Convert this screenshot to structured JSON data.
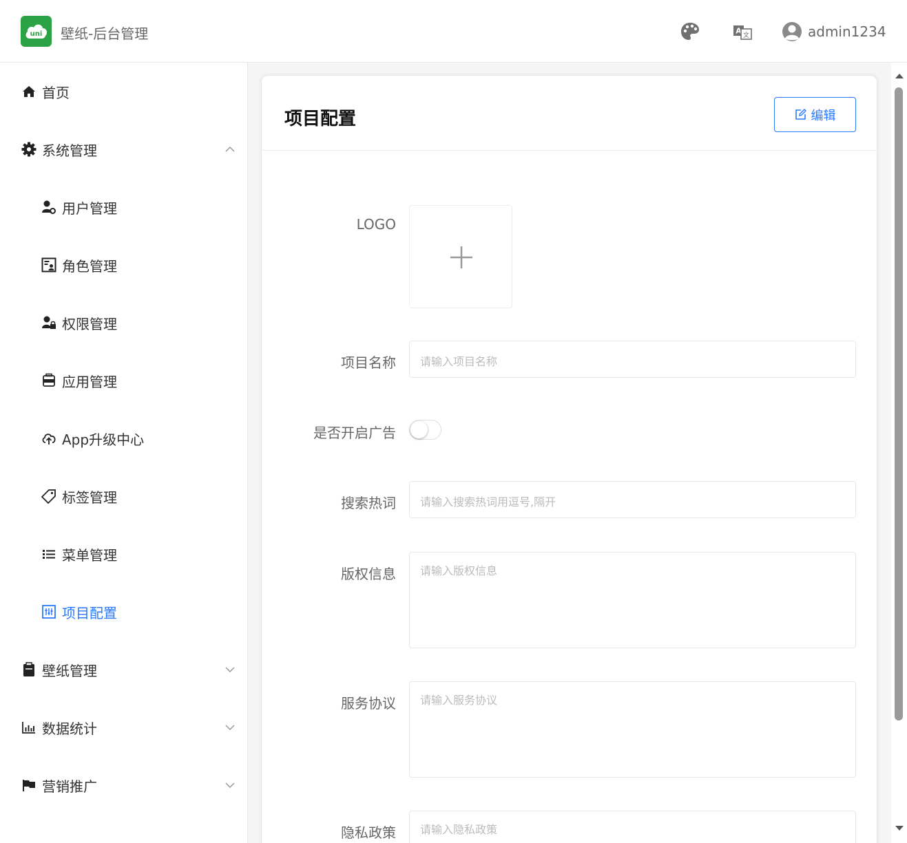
{
  "header": {
    "app_title": "壁纸-后台管理",
    "logo_text": "uni",
    "username": "admin1234",
    "icons": [
      "palette-icon",
      "translate-icon",
      "user-avatar-icon"
    ]
  },
  "sidebar": {
    "items": [
      {
        "label": "首页",
        "icon": "home-icon",
        "level": "top"
      },
      {
        "label": "系统管理",
        "icon": "gear-icon",
        "level": "top",
        "expanded": true
      },
      {
        "label": "用户管理",
        "icon": "user-settings-icon",
        "level": "sub"
      },
      {
        "label": "角色管理",
        "icon": "role-card-icon",
        "level": "sub"
      },
      {
        "label": "权限管理",
        "icon": "user-lock-icon",
        "level": "sub"
      },
      {
        "label": "应用管理",
        "icon": "app-icon",
        "level": "sub"
      },
      {
        "label": "App升级中心",
        "icon": "cloud-upload-icon",
        "level": "sub"
      },
      {
        "label": "标签管理",
        "icon": "tag-icon",
        "level": "sub"
      },
      {
        "label": "菜单管理",
        "icon": "list-icon",
        "level": "sub"
      },
      {
        "label": "项目配置",
        "icon": "config-icon",
        "level": "sub",
        "active": true
      },
      {
        "label": "壁纸管理",
        "icon": "clipboard-icon",
        "level": "top",
        "expanded": false
      },
      {
        "label": "数据统计",
        "icon": "bar-chart-icon",
        "level": "top",
        "expanded": false
      },
      {
        "label": "营销推广",
        "icon": "flag-icon",
        "level": "top",
        "expanded": false
      }
    ]
  },
  "main": {
    "title": "项目配置",
    "edit_label": "编辑",
    "form": {
      "logo_label": "LOGO",
      "name_label": "项目名称",
      "name_placeholder": "请输入项目名称",
      "ad_label": "是否开启广告",
      "ad_enabled": false,
      "hotwords_label": "搜索热词",
      "hotwords_placeholder": "请输入搜索热词用逗号,隔开",
      "copyright_label": "版权信息",
      "copyright_placeholder": "请输入版权信息",
      "service_label": "服务协议",
      "service_placeholder": "请输入服务协议",
      "privacy_label": "隐私政策",
      "privacy_placeholder": "请输入隐私政策"
    }
  },
  "colors": {
    "accent": "#2979ff",
    "brand_green": "#2ba245",
    "text": "#333333",
    "muted": "#666666",
    "placeholder": "#bbbbbb"
  }
}
